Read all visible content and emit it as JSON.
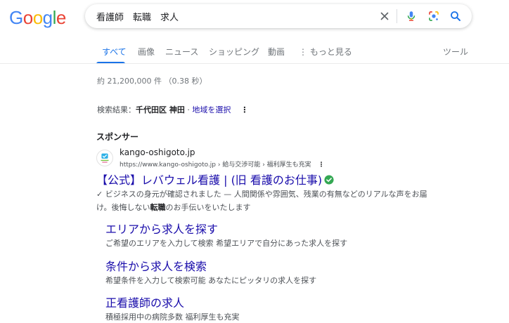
{
  "logo": {
    "letters": [
      "G",
      "o",
      "o",
      "g",
      "l",
      "e"
    ],
    "colors": [
      "#4285f4",
      "#ea4335",
      "#fbbc05",
      "#4285f4",
      "#34a853",
      "#ea4335"
    ]
  },
  "search": {
    "query": "看護師　転職　求人",
    "clear_icon": "close-icon",
    "voice_icon": "mic-icon",
    "lens_icon": "lens-icon",
    "submit_icon": "search-icon"
  },
  "tabs": [
    {
      "label": "すべて",
      "active": true
    },
    {
      "label": "画像"
    },
    {
      "label": "ニュース"
    },
    {
      "label": "ショッピング"
    },
    {
      "label": "動画"
    },
    {
      "label": "⋮ もっと見る"
    }
  ],
  "tools_label": "ツール",
  "stats": "約 21,200,000 件 （0.38 秒）",
  "location": {
    "prefix": "検索結果：",
    "place": "千代田区 神田",
    "separator": " · ",
    "link": "地域を選択",
    "more": "⋮"
  },
  "ad": {
    "sponsor_label": "スポンサー",
    "site_name": "kango-oshigoto.jp",
    "site_url": "https://www.kango-oshigoto.jp › 給与交渉可能 › 福利厚生も充実",
    "kebab": "⋮",
    "title": "【公式】レバウェル看護 | (旧 看護のお仕事)",
    "desc_check": "✓ ",
    "desc_part1": "ビジネスの身元が確認されました — 人間関係や雰囲気、残業の有無などのリアルな声をお届け。後悔しない",
    "desc_bold": "転職",
    "desc_part2": "のお手伝いをいたします",
    "colors": {
      "link": "#1a0dab",
      "verified": "#34a853"
    }
  },
  "sitelinks": [
    {
      "title": "エリアから求人を探す",
      "desc": "ご希望のエリアを入力して検索 希望エリアで自分にあった求人を探す"
    },
    {
      "title": "条件から求人を検索",
      "desc": "希望条件を入力して検索可能 あなたにピッタリの求人を探す"
    },
    {
      "title": "正看護師の求人",
      "desc": "積極採用中の病院多数 福利厚生も充実"
    }
  ]
}
